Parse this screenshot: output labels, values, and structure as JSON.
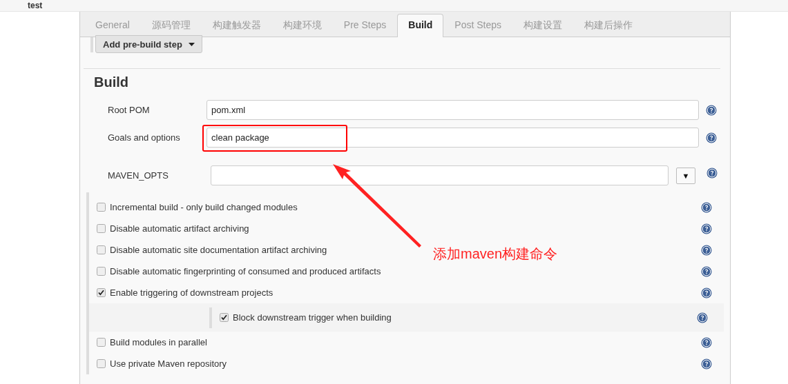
{
  "breadcrumb": {
    "title": "test"
  },
  "tabs": [
    {
      "label": "General",
      "selected": false
    },
    {
      "label": "源码管理",
      "selected": false
    },
    {
      "label": "构建触发器",
      "selected": false
    },
    {
      "label": "构建环境",
      "selected": false
    },
    {
      "label": "Pre Steps",
      "selected": false
    },
    {
      "label": "Build",
      "selected": true
    },
    {
      "label": "Post Steps",
      "selected": false
    },
    {
      "label": "构建设置",
      "selected": false
    },
    {
      "label": "构建后操作",
      "selected": false
    }
  ],
  "pre_build_button": {
    "label": "Add pre-build step"
  },
  "section": {
    "title": "Build"
  },
  "fields": [
    {
      "kind": "text",
      "label": "Root POM",
      "value": "pom.xml",
      "highlighted": false
    },
    {
      "kind": "text",
      "label": "Goals and options",
      "value": "clean package",
      "highlighted": true
    },
    {
      "kind": "dropdown",
      "label": "MAVEN_OPTS",
      "toggle": "▼",
      "highlighted": false
    }
  ],
  "options": [
    {
      "label": "Incremental build - only build changed modules",
      "checked": false
    },
    {
      "label": "Disable automatic artifact archiving",
      "checked": false
    },
    {
      "label": "Disable automatic site documentation artifact archiving",
      "checked": false
    },
    {
      "label": "Disable automatic fingerprinting of consumed and produced artifacts",
      "checked": false
    },
    {
      "label": "Enable triggering of downstream projects",
      "checked": true,
      "children": [
        {
          "label": "Block downstream trigger when building",
          "checked": true
        }
      ]
    },
    {
      "label": "Build modules in parallel",
      "checked": false
    },
    {
      "label": "Use private Maven repository",
      "checked": false
    }
  ],
  "annotation": {
    "text": "添加maven构建命令"
  }
}
